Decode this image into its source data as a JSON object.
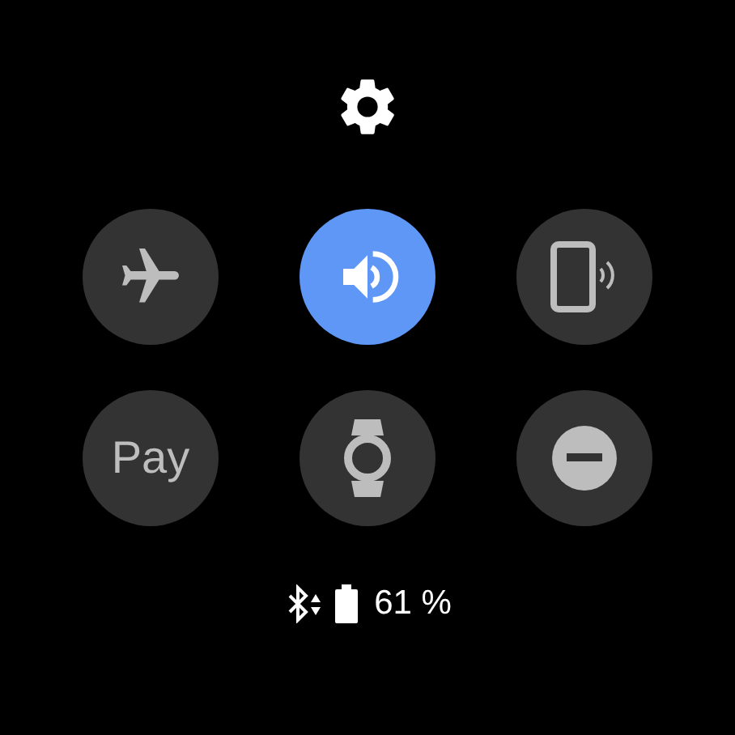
{
  "tiles": [
    {
      "kind": "airplane",
      "selected": false
    },
    {
      "kind": "sound",
      "selected": true
    },
    {
      "kind": "phone-vibrate",
      "selected": false
    },
    {
      "kind": "pay",
      "label": "Pay",
      "selected": false
    },
    {
      "kind": "watch",
      "selected": false
    },
    {
      "kind": "do-not-disturb",
      "selected": false
    }
  ],
  "status": {
    "battery": "61 %"
  }
}
